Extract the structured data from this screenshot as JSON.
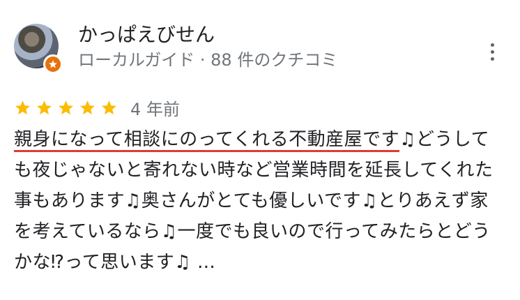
{
  "reviewer": {
    "name": "かっぱえびせん",
    "meta": "ローカルガイド · 88 件のクチコミ",
    "avatar_icon": "avatar-photo",
    "badge_icon": "local-guide-star-icon",
    "badge_color": "#e8710a"
  },
  "menu": {
    "icon": "more-vert-icon"
  },
  "rating": {
    "stars": 5,
    "max": 5,
    "star_color": "#fbbc04",
    "date": "4 年前"
  },
  "review": {
    "highlighted": "親身になって相談にのってくれる不動産屋です",
    "rest": "♫どうしても夜じゃないと寄れない時など営業時間を延長してくれた事もあります♫奥さんがとても優しいです♫とりあえず家を考えているなら♫一度でも良いので行ってみたらとどうかな⁉︎って思います♫ …",
    "highlight_color": "#e03b34"
  }
}
